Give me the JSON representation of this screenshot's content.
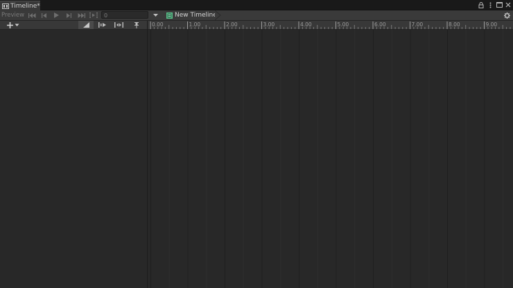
{
  "window": {
    "tab_title": "Timeline*",
    "controls": [
      "lock-icon",
      "kebab-menu-icon",
      "maximize-icon",
      "close-icon"
    ]
  },
  "toolbar": {
    "preview_label": "Preview",
    "frame_value": "0",
    "breadcrumb_label": "New Timeline"
  },
  "ruler": {
    "start": 0,
    "end": 9,
    "major_step": 1,
    "minor_per_major": 10,
    "labels": [
      "0.00",
      "1.00",
      "2.00",
      "3.00",
      "4.00",
      "5.00",
      "6.00",
      "7.00",
      "8.00",
      "9.00"
    ]
  },
  "colors": {
    "background": "#282828",
    "toolbar": "#3a3a3a",
    "grid_major": "#1f1f1f",
    "grid_half": "#2e2e2e",
    "timeline_icon_green": "#5bbf8a"
  }
}
